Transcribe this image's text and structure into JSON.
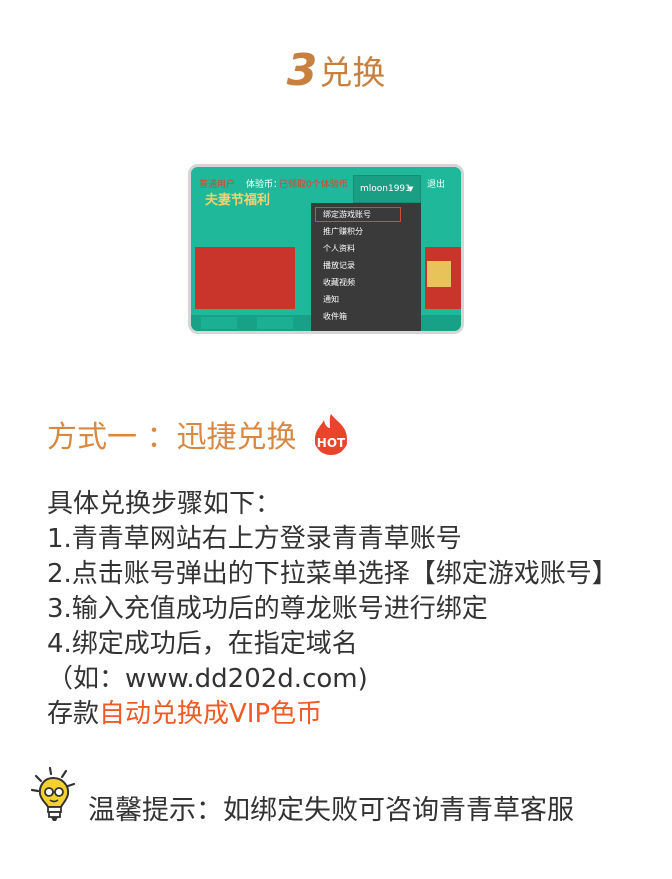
{
  "header": {
    "step_number": "3",
    "title": "兑换"
  },
  "screenshot": {
    "topbar": {
      "red_text_1": "普通用户",
      "experience_label": "体验币：",
      "red_text_2": "已领取0个体验币",
      "username": "mloon1991",
      "logout": "退出"
    },
    "menu": {
      "items": [
        "绑定游戏账号",
        "推广赚积分",
        "个人资料",
        "播放记录",
        "收藏视频",
        "通知",
        "收件箱"
      ]
    },
    "banner_text": "夫妻节福利"
  },
  "method": {
    "title": "方式一 ：迅捷兑换",
    "hot_label": "HOT"
  },
  "instructions": {
    "intro": "具体兑换步骤如下：",
    "step1": "1.青青草网站右上方登录青青草账号",
    "step2": "2.点击账号弹出的下拉菜单选择【绑定游戏账号】",
    "step3": "3.输入充值成功后的尊龙账号进行绑定",
    "step4": "4.绑定成功后，在指定域名",
    "domain_line": "（如：www.dd202d.com)",
    "deposit_prefix": "存款",
    "deposit_highlight": "自动兑换成VIP色币"
  },
  "tip": {
    "text": "温馨提示：如绑定失败可咨询青青草客服"
  },
  "colors": {
    "accent_brown": "#c7803f",
    "accent_orange": "#f05a23",
    "teal": "#1fb89a",
    "hot_red": "#e8452c"
  },
  "icons": {
    "hot": "hot-flame-icon",
    "tip": "lightbulb-icon"
  }
}
